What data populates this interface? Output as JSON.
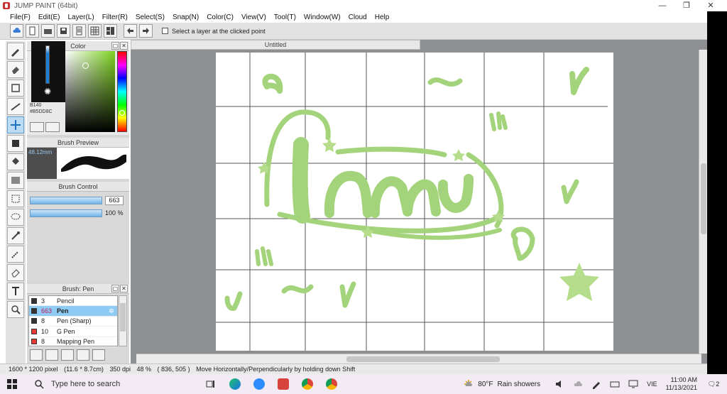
{
  "window": {
    "title": "JUMP PAINT (64bit)",
    "controls": [
      "—",
      "❐",
      "✕"
    ]
  },
  "menu": [
    "File(F)",
    "Edit(E)",
    "Layer(L)",
    "Filter(R)",
    "Select(S)",
    "Snap(N)",
    "Color(C)",
    "View(V)",
    "Tool(T)",
    "Window(W)",
    "Cloud",
    "Help"
  ],
  "toolbar": {
    "select_layer_label": "Select a layer at the clicked point"
  },
  "color_panel": {
    "title": "Color",
    "info_line1": "B140",
    "hex": "#B5DD8C"
  },
  "brush_preview": {
    "title": "Brush Preview",
    "size": "48.12mm"
  },
  "brush_control": {
    "title": "Brush Control",
    "size_value": "663",
    "opacity_value": "100 %"
  },
  "brush_list": {
    "title": "Brush: Pen",
    "items": [
      {
        "size": "3",
        "name": "Pencil",
        "color": "#333333"
      },
      {
        "size": "663",
        "name": "Pen",
        "color": "#333333"
      },
      {
        "size": "8",
        "name": "Pen (Sharp)",
        "color": "#333333"
      },
      {
        "size": "10",
        "name": "G Pen",
        "color": "#e53935"
      },
      {
        "size": "8",
        "name": "Mapping Pen",
        "color": "#e53935"
      }
    ]
  },
  "document": {
    "tab": "Untitled"
  },
  "drawing": {
    "accent": "#B5DD8C",
    "shade": "#A3D37A"
  },
  "status": {
    "resolution": "1600 * 1200 pixel",
    "physical": "(11.6 * 8.7cm)",
    "dpi": "350 dpi",
    "zoom": "48 %",
    "coords": "( 836, 505 )",
    "hint": "Move Horizontally/Perpendicularly by holding down Shift"
  },
  "taskbar": {
    "search_placeholder": "Type here to search",
    "weather_temp": "80°F",
    "weather_text": "Rain showers",
    "lang": "VIE",
    "time": "11:00 AM",
    "date": "11/13/2021",
    "notifications": "2"
  }
}
